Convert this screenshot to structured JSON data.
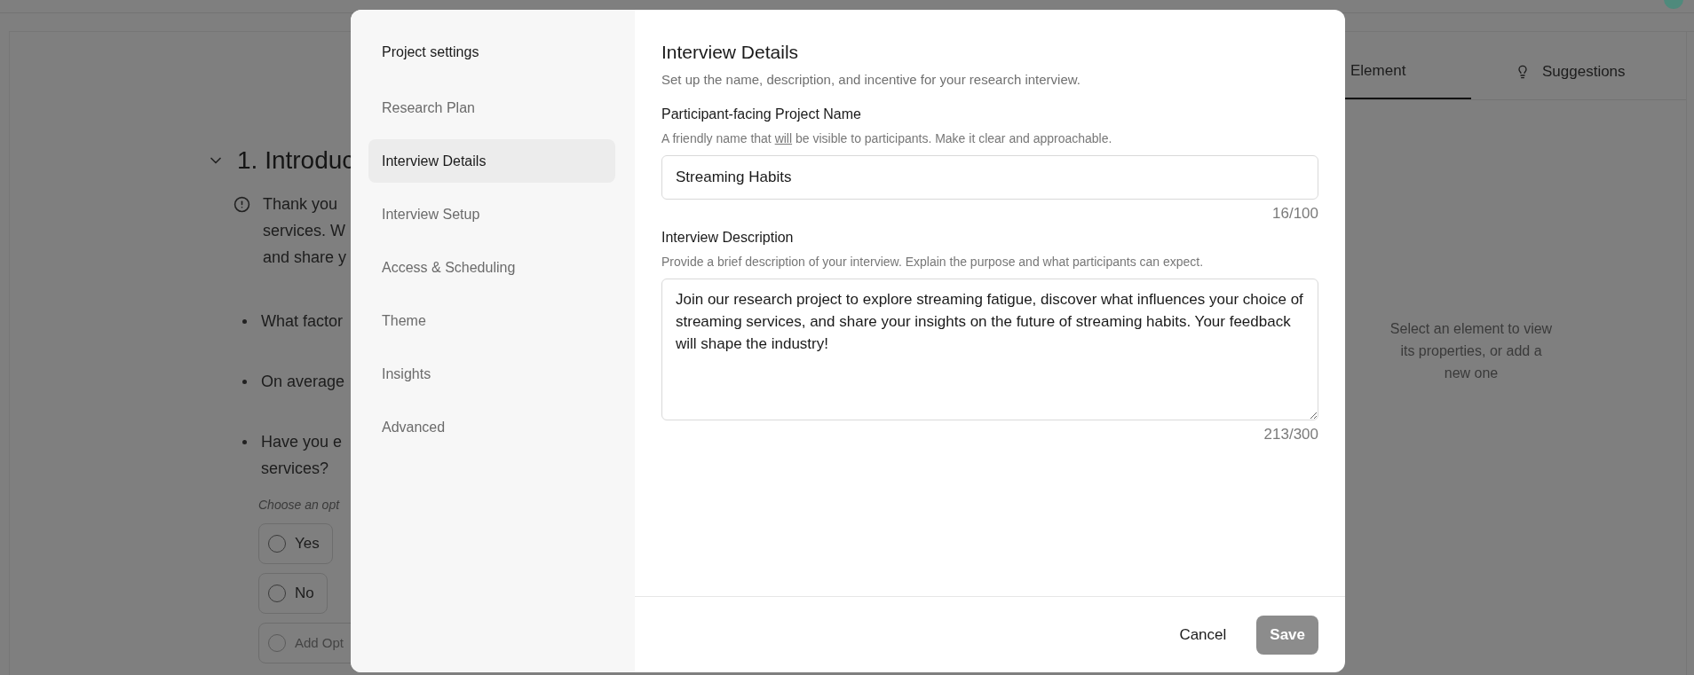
{
  "background": {
    "section": {
      "title": "1. Introduc",
      "expanded": true
    },
    "intro_lines": [
      "Thank you",
      "services. W",
      "and share y"
    ],
    "questions": [
      {
        "lines": [
          "What factor"
        ]
      },
      {
        "lines": [
          "On average"
        ]
      },
      {
        "lines": [
          "Have you e",
          "services?"
        ]
      }
    ],
    "choice_hint": "Choose an opt",
    "options": [
      {
        "kind": "option",
        "label": "Yes"
      },
      {
        "kind": "option",
        "label": "No"
      },
      {
        "kind": "add",
        "label": "Add Opt"
      }
    ],
    "panel_tabs": [
      {
        "label": "Element",
        "selected": true,
        "kind": "plain"
      },
      {
        "label": "Suggestions",
        "selected": false,
        "kind": "bulb"
      }
    ],
    "empty_message": "Select an element to view its properties, or add a new one"
  },
  "dialog": {
    "sidebar": {
      "title": "Project settings",
      "items": [
        {
          "label": "Research Plan",
          "selected": false
        },
        {
          "label": "Interview Details",
          "selected": true
        },
        {
          "label": "Interview Setup",
          "selected": false
        },
        {
          "label": "Access & Scheduling",
          "selected": false
        },
        {
          "label": "Theme",
          "selected": false
        },
        {
          "label": "Insights",
          "selected": false
        },
        {
          "label": "Advanced",
          "selected": false
        }
      ]
    },
    "title": "Interview Details",
    "subtitle": "Set up the name, description, and incentive for your research interview.",
    "fields": [
      {
        "kind": "input",
        "label": "Participant-facing Project Name",
        "hint_parts": [
          {
            "text": "A friendly name that ",
            "underline": false
          },
          {
            "text": "will",
            "underline": true
          },
          {
            "text": " be visible to participants. Make it clear and approachable.",
            "underline": false
          }
        ],
        "value": "Streaming Habits",
        "counter": "16/100"
      },
      {
        "kind": "textarea",
        "label": "Interview Description",
        "hint_parts": [
          {
            "text": "Provide a brief description of your interview. Explain the purpose and what participants can expect.",
            "underline": false
          }
        ],
        "value": "Join our research project to explore streaming fatigue, discover what influences your choice of streaming services, and share your insights on the future of streaming habits. Your feedback will shape the industry!",
        "counter": "213/300"
      }
    ],
    "cancel": {
      "label": "Cancel"
    },
    "save": {
      "label": "Save",
      "disabled": true
    }
  }
}
